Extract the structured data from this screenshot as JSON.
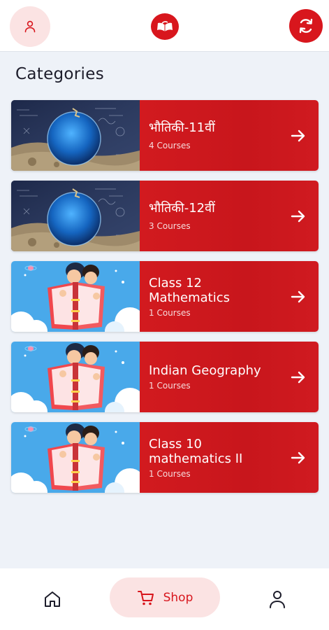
{
  "header": {
    "profile_icon": "user-icon",
    "logo_icon": "open-book-logo",
    "refresh_icon": "refresh-icon"
  },
  "page": {
    "title": "Categories"
  },
  "categories": [
    {
      "title": "भौतिकी-11वीं",
      "count": "4 Courses",
      "thumb": "nand-research-zone-thumbnail"
    },
    {
      "title": "भौतिकी-12वीं",
      "count": "3 Courses",
      "thumb": "nand-research-zone-thumbnail"
    },
    {
      "title": "Class 12 Mathematics",
      "count": "1 Courses",
      "thumb": "kids-reading-book-thumbnail"
    },
    {
      "title": "Indian Geography",
      "count": "1 Courses",
      "thumb": "kids-reading-book-thumbnail"
    },
    {
      "title": "Class 10 mathematics II",
      "count": "1 Courses",
      "thumb": "kids-reading-book-thumbnail"
    }
  ],
  "bottom_nav": {
    "home_icon": "home-icon",
    "shop_label": "Shop",
    "shop_icon": "cart-icon",
    "profile_icon": "user-icon"
  },
  "colors": {
    "accent": "#d8161d",
    "accent_soft": "#fbe3e3",
    "background": "#eef2f8"
  }
}
